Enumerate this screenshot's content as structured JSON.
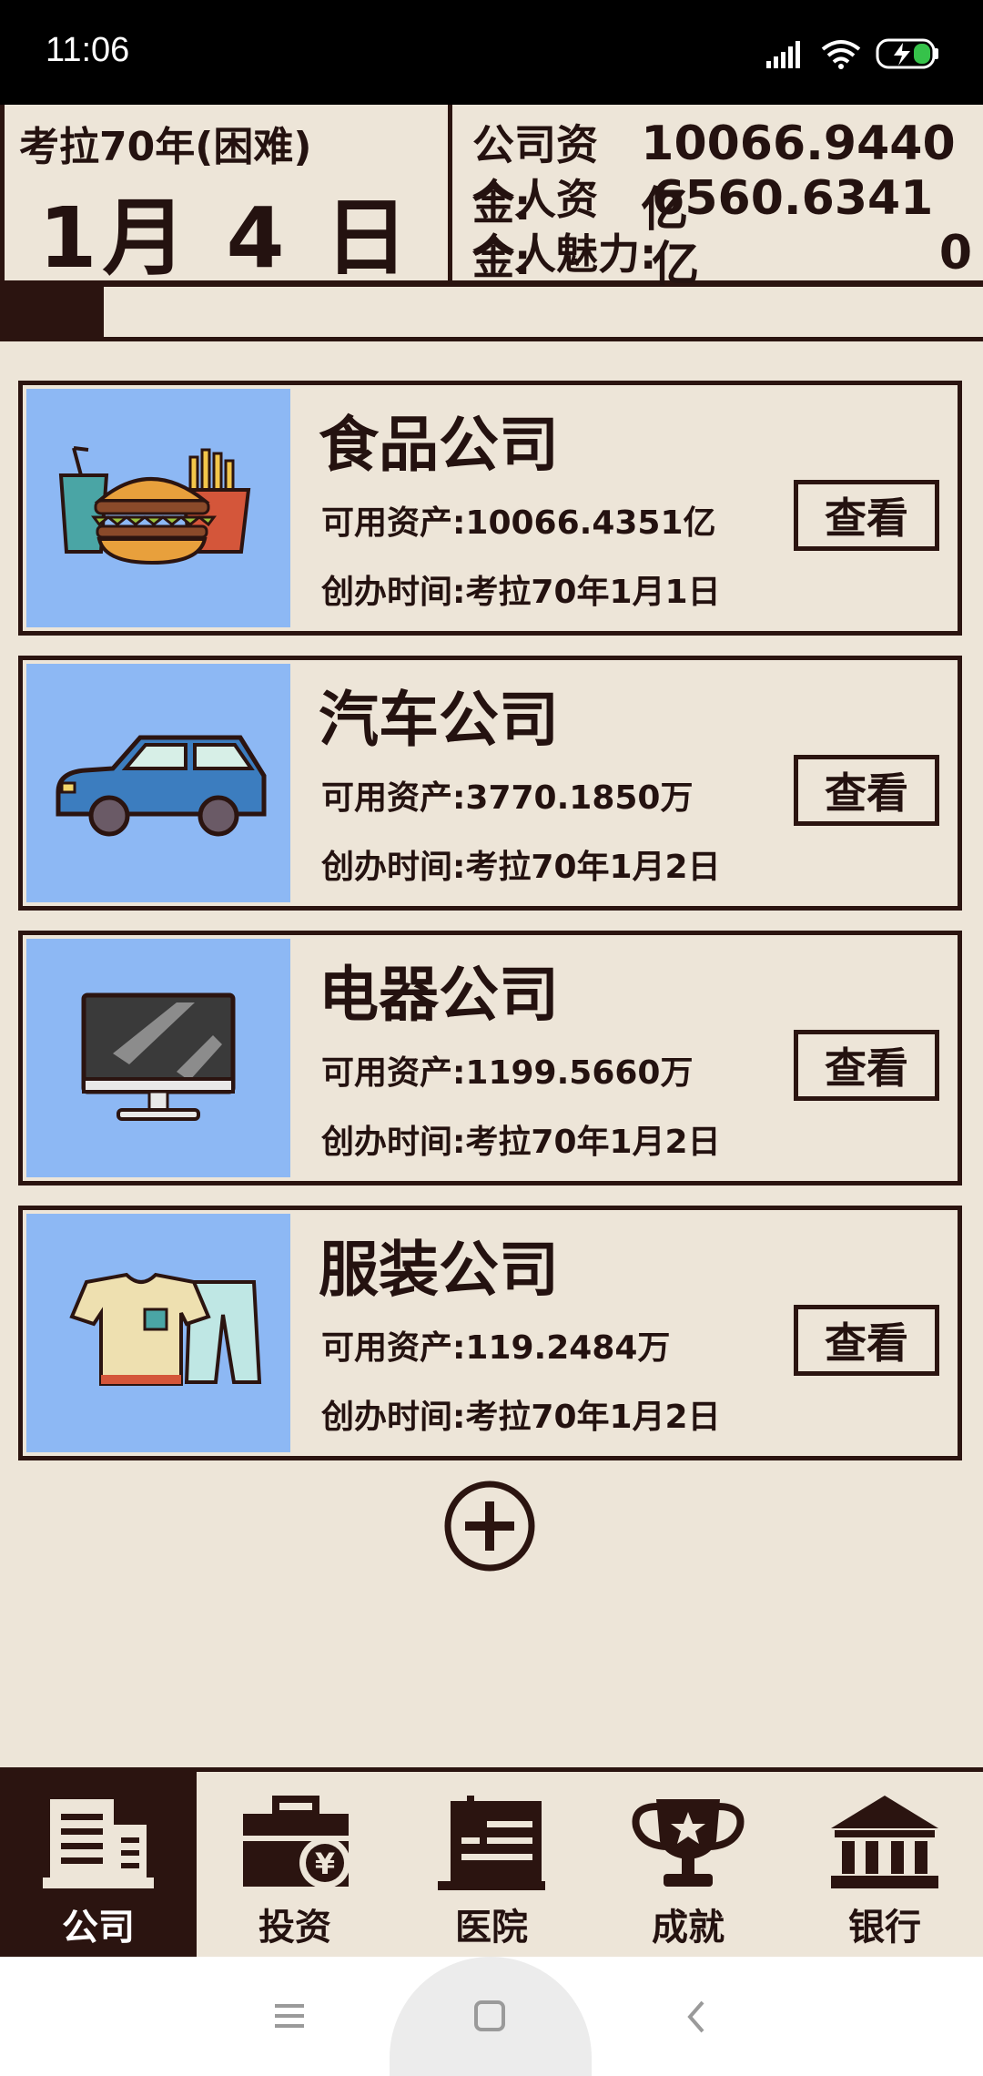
{
  "status_bar": {
    "time": "11:06",
    "icons": [
      "signal-icon",
      "wifi-icon",
      "battery-charging-icon"
    ]
  },
  "header": {
    "scenario": "考拉70年(困难)",
    "date": "1月 4 日",
    "company_funds_label": "公司资金:",
    "company_funds_value": "10066.9440亿",
    "personal_funds_label": "个人资金:",
    "personal_funds_value": "6560.6341亿",
    "charm_label": "个人魅力:",
    "charm_value": "0"
  },
  "progress": {
    "fraction": 0.106
  },
  "companies": [
    {
      "name": "食品公司",
      "assets": "可用资产:10066.4351亿",
      "founded": "创办时间:考拉70年1月1日",
      "button": "查看",
      "icon": "fastfood-icon"
    },
    {
      "name": "汽车公司",
      "assets": "可用资产:3770.1850万",
      "founded": "创办时间:考拉70年1月2日",
      "button": "查看",
      "icon": "car-icon"
    },
    {
      "name": "电器公司",
      "assets": "可用资产:1199.5660万",
      "founded": "创办时间:考拉70年1月2日",
      "button": "查看",
      "icon": "monitor-icon"
    },
    {
      "name": "服装公司",
      "assets": "可用资产:119.2484万",
      "founded": "创办时间:考拉70年1月2日",
      "button": "查看",
      "icon": "clothing-icon"
    }
  ],
  "add_button_icon": "plus-circle-icon",
  "nav": [
    {
      "label": "公司",
      "icon": "building-icon",
      "active": true
    },
    {
      "label": "投资",
      "icon": "briefcase-yen-icon",
      "active": false
    },
    {
      "label": "医院",
      "icon": "hospital-icon",
      "active": false
    },
    {
      "label": "成就",
      "icon": "trophy-icon",
      "active": false
    },
    {
      "label": "银行",
      "icon": "bank-icon",
      "active": false
    }
  ],
  "system_nav": [
    "menu-icon",
    "home-icon",
    "back-icon"
  ],
  "colors": {
    "background": "#ede5d8",
    "ink": "#2b1410",
    "card_image_bg": "#8db8f4",
    "active_tab": "#2b1410"
  }
}
